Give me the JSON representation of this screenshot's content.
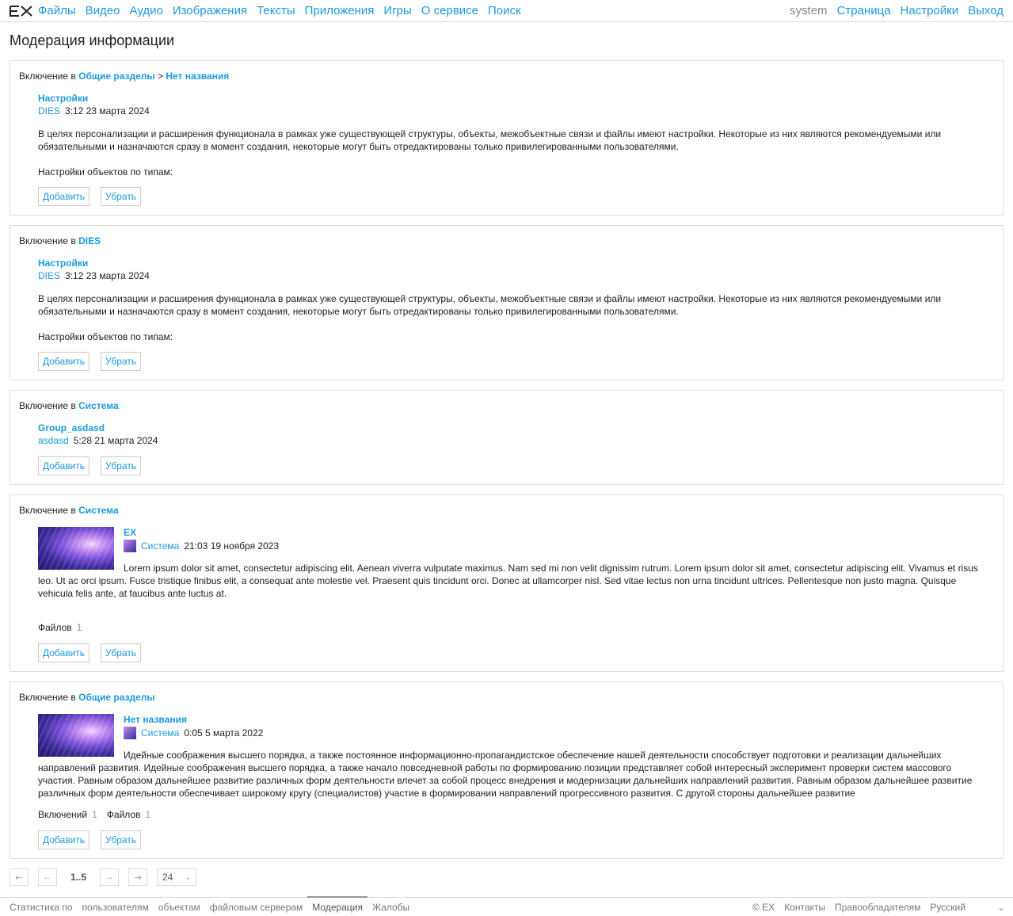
{
  "nav": {
    "logo": "EX",
    "items": [
      "Файлы",
      "Видео",
      "Аудио",
      "Изображения",
      "Тексты",
      "Приложения",
      "Игры",
      "О сервисе",
      "Поиск"
    ],
    "user": "system",
    "right": [
      "Страница",
      "Настройки",
      "Выход"
    ]
  },
  "page_title": "Модерация информации",
  "labels": {
    "include_in": "Включение в",
    "breadcrumb_sep": ">",
    "add": "Добавить",
    "remove": "Убрать",
    "settings_by_type": "Настройки объектов по типам:",
    "files": "Файлов",
    "inclusions": "Включений"
  },
  "cards": [
    {
      "target": "Общие разделы",
      "target2": "Нет названия",
      "title": "Настройки",
      "author": "DIES",
      "time": "3:12 23 марта 2024",
      "text": "В целях персонализации и расширения функционала в рамках уже существующей структуры, объекты, межобъектные связи и файлы имеют настройки. Некоторые из них являются рекомендуемыми или обязательными и назначаются сразу в момент создания, некоторые могут быть отредактированы только привилегированными пользователями."
    },
    {
      "target": "DIES",
      "title": "Настройки",
      "author": "DIES",
      "time": "3:12 23 марта 2024",
      "text": "В целях персонализации и расширения функционала в рамках уже существующей структуры, объекты, межобъектные связи и файлы имеют настройки. Некоторые из них являются рекомендуемыми или обязательными и назначаются сразу в момент создания, некоторые могут быть отредактированы только привилегированными пользователями."
    },
    {
      "target": "Система",
      "title": "Group_asdasd",
      "author": "asdasd",
      "time": "5:28 21 марта 2024"
    },
    {
      "target": "Система",
      "title": "EX",
      "author": "Система",
      "time": "21:03 19 ноября 2023",
      "text": "Lorem ipsum dolor sit amet, consectetur adipiscing elit. Aenean viverra vulputate maximus. Nam sed mi non velit dignissim rutrum. Lorem ipsum dolor sit amet, consectetur adipiscing elit. Vivamus et risus leo. Ut ac orci ipsum. Fusce tristique finibus elit, a consequat ante molestie vel. Praesent quis tincidunt orci. Donec at ullamcorper nisl. Sed vitae lectus non urna tincidunt ultrices. Pellentesque non justo magna. Quisque vehicula felis ante, at faucibus ante luctus at.",
      "files": "1"
    },
    {
      "target": "Общие разделы",
      "title": "Нет названия",
      "author": "Система",
      "time": "0:05 5 марта 2022",
      "text": "Идейные соображения высшего порядка, а также постоянное информационно-пропагандистское обеспечение нашей деятельности способствует подготовки и реализации дальнейших направлений развития. Идейные соображения высшего порядка, а также начало повседневной работы по формированию позиции представляет собой интересный эксперимент проверки систем массового участия. Равным образом дальнейшее развитие различных форм деятельности влечет за собой процесс внедрения и модернизации дальнейших направлений развития. Равным образом дальнейшее развитие различных форм деятельности обеспечивает широкому кругу (специалистов) участие в формировании направлений прогрессивного развития. С другой стороны дальнейшее развитие",
      "inclusions": "1",
      "files": "1"
    }
  ],
  "pager": {
    "first_icon": "first-page-icon",
    "prev_icon": "prev-page-icon",
    "pages": "1..5",
    "next_icon": "next-page-icon",
    "last_icon": "last-page-icon",
    "per_page": "24"
  },
  "footer": {
    "left": [
      "Статистика по",
      "пользователям",
      "объектам",
      "файловым серверам",
      "Модерация",
      "Жалобы"
    ],
    "right": [
      "© EX",
      "Контакты",
      "Правообладателям",
      "Русский"
    ]
  },
  "colors": {
    "link": "#1a9ae0",
    "border": "#dddddd"
  }
}
